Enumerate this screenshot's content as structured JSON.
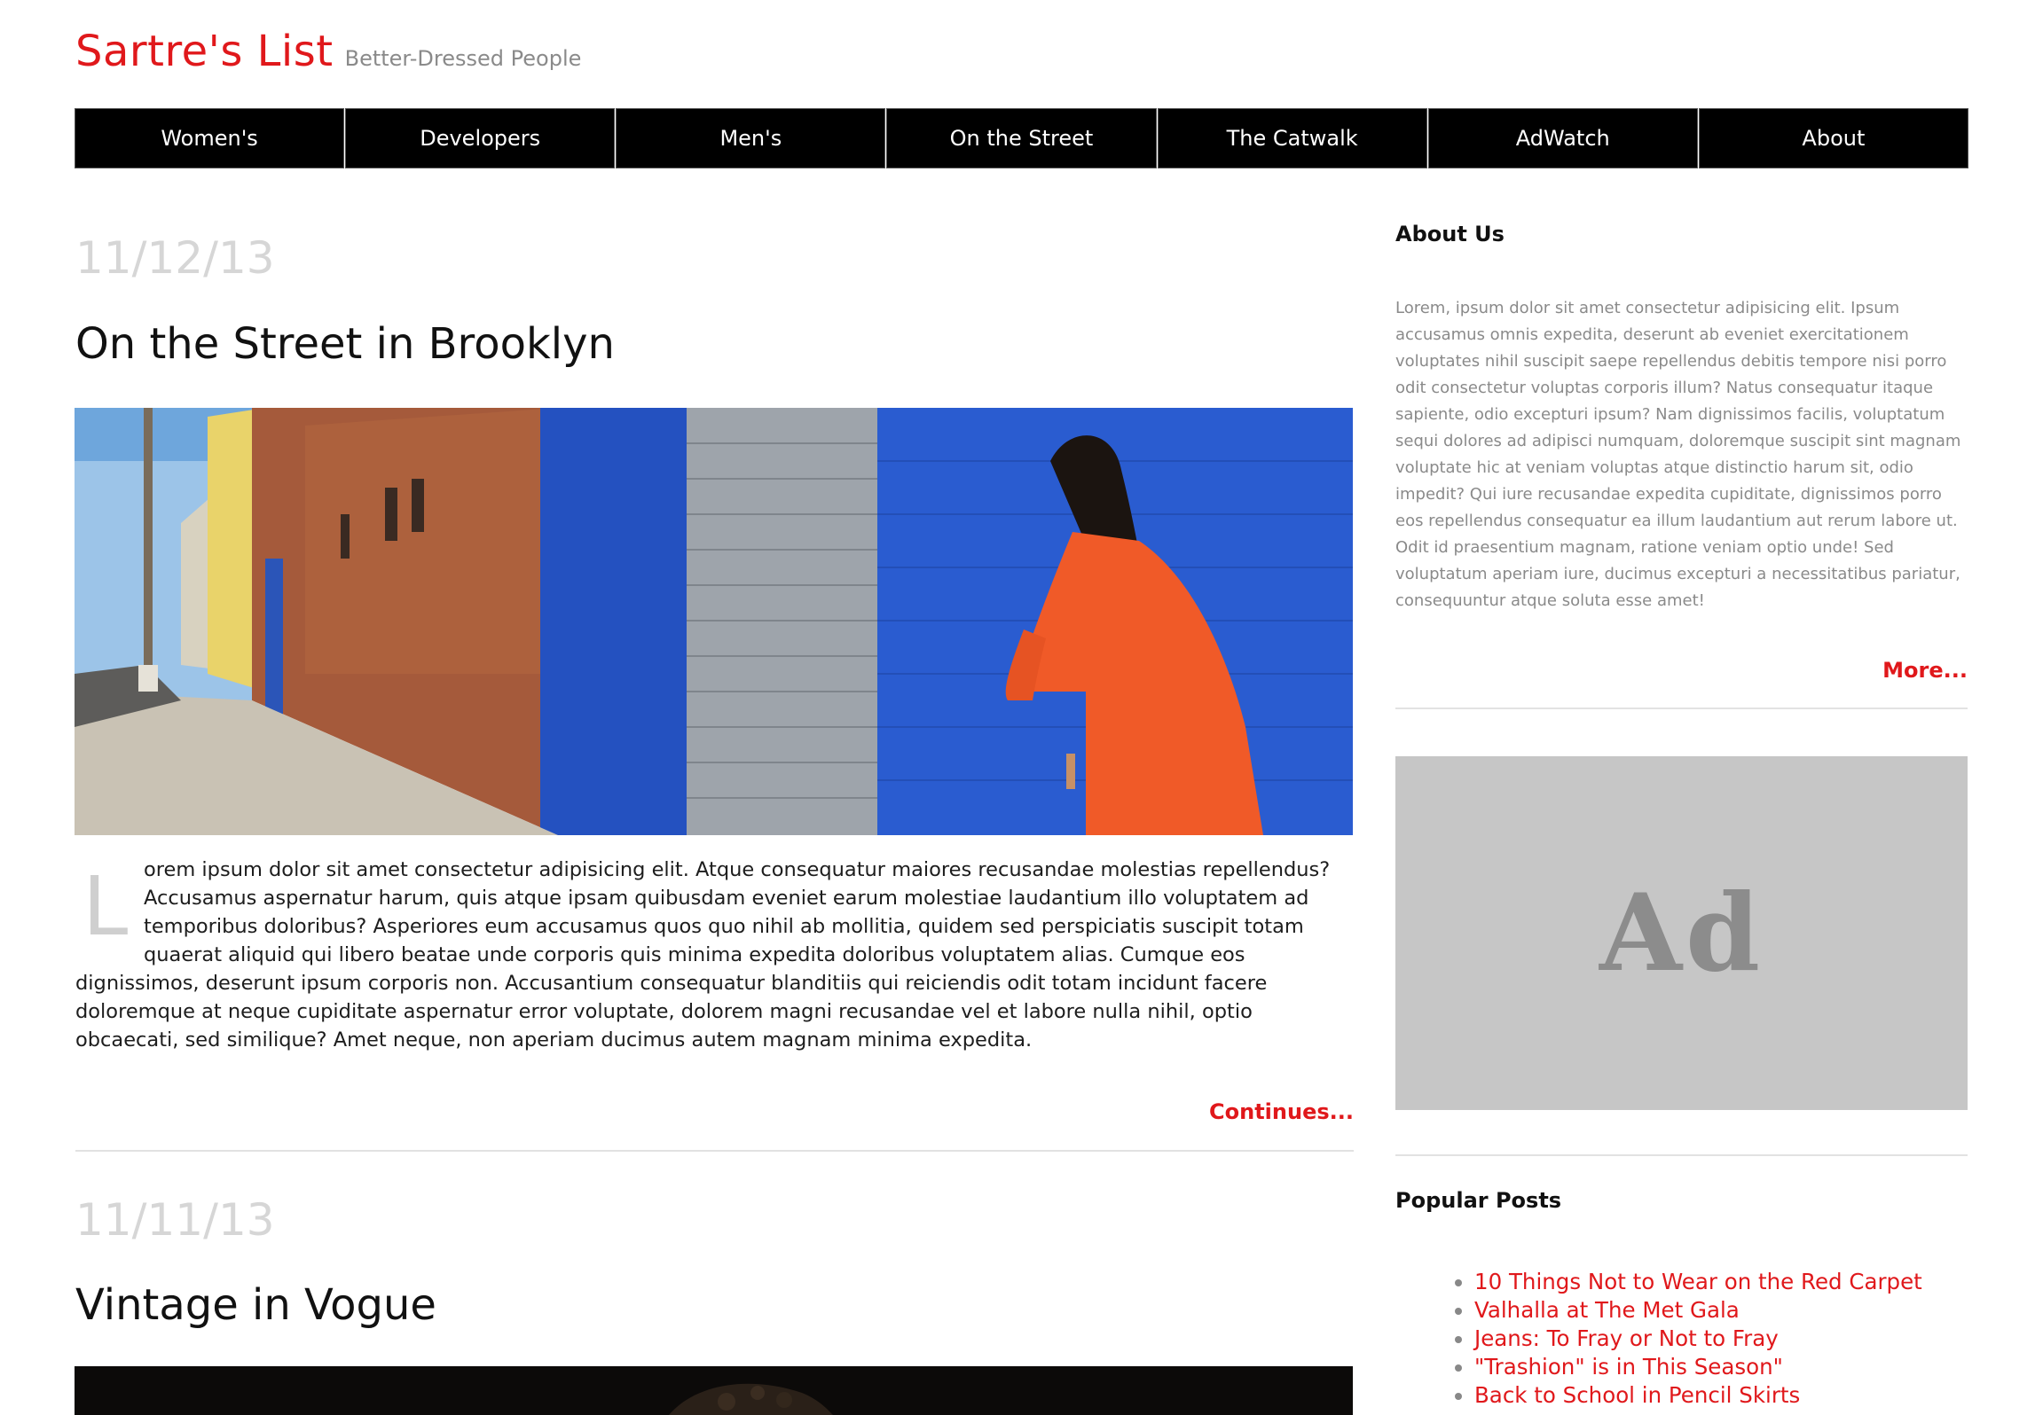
{
  "site": {
    "title": "Sartre's List",
    "tagline": "Better-Dressed People"
  },
  "nav": {
    "items": [
      {
        "label": "Women's"
      },
      {
        "label": "Developers"
      },
      {
        "label": "Men's"
      },
      {
        "label": "On the Street"
      },
      {
        "label": "The Catwalk"
      },
      {
        "label": "AdWatch"
      },
      {
        "label": "About"
      }
    ]
  },
  "posts": [
    {
      "date": "11/12/13",
      "title": "On the Street in Brooklyn",
      "dropcap": "L",
      "body": "orem ipsum dolor sit amet consectetur adipisicing elit. Atque consequatur maiores recusandae molestias repellendus? Accusamus aspernatur harum, quis atque ipsam quibusdam eveniet earum molestiae laudantium illo voluptatem ad temporibus doloribus? Asperiores eum accusamus quos quo nihil ab mollitia, quidem sed perspiciatis suscipit totam quaerat aliquid qui libero beatae unde corporis quis minima expedita doloribus voluptatem alias. Cumque eos dignissimos, deserunt ipsum corporis non. Accusantium consequatur blanditiis qui reiciendis odit totam incidunt facere doloremque at neque cupiditate aspernatur error voluptate, dolorem magni recusandae vel et labore nulla nihil, optio obcaecati, sed similique? Amet neque, non aperiam ducimus autem magnam minima expedita.",
      "continue_label": "Continues..."
    },
    {
      "date": "11/11/13",
      "title": "Vintage in Vogue"
    }
  ],
  "sidebar": {
    "about": {
      "heading": "About Us",
      "text": "Lorem, ipsum dolor sit amet consectetur adipisicing elit. Ipsum accusamus omnis expedita, deserunt ab eveniet exercitationem voluptates nihil suscipit saepe repellendus debitis tempore nisi porro odit consectetur voluptas corporis illum? Natus consequatur itaque sapiente, odio excepturi ipsum? Nam dignissimos facilis, voluptatum sequi dolores ad adipisci numquam, doloremque suscipit sint magnam voluptate hic at veniam voluptas atque distinctio harum sit, odio impedit? Qui iure recusandae expedita cupiditate, dignissimos porro eos repellendus consequatur ea illum laudantium aut rerum labore ut. Odit id praesentium magnam, ratione veniam optio unde! Sed voluptatum aperiam iure, ducimus excepturi a necessitatibus pariatur, consequuntur atque soluta esse amet!",
      "more_label": "More..."
    },
    "ad": {
      "label": "Ad"
    },
    "popular": {
      "heading": "Popular Posts",
      "items": [
        "10 Things Not to Wear on the Red Carpet",
        "Valhalla at The Met Gala",
        "Jeans: To Fray or Not to Fray",
        "\"Trashion\" is in This Season\"",
        "Back to School in Pencil Skirts"
      ]
    }
  },
  "colors": {
    "brand_red": "#e0181b",
    "nav_bg": "#000000",
    "date_gray": "#d6d6d6",
    "ad_bg": "#c6c6c6"
  }
}
